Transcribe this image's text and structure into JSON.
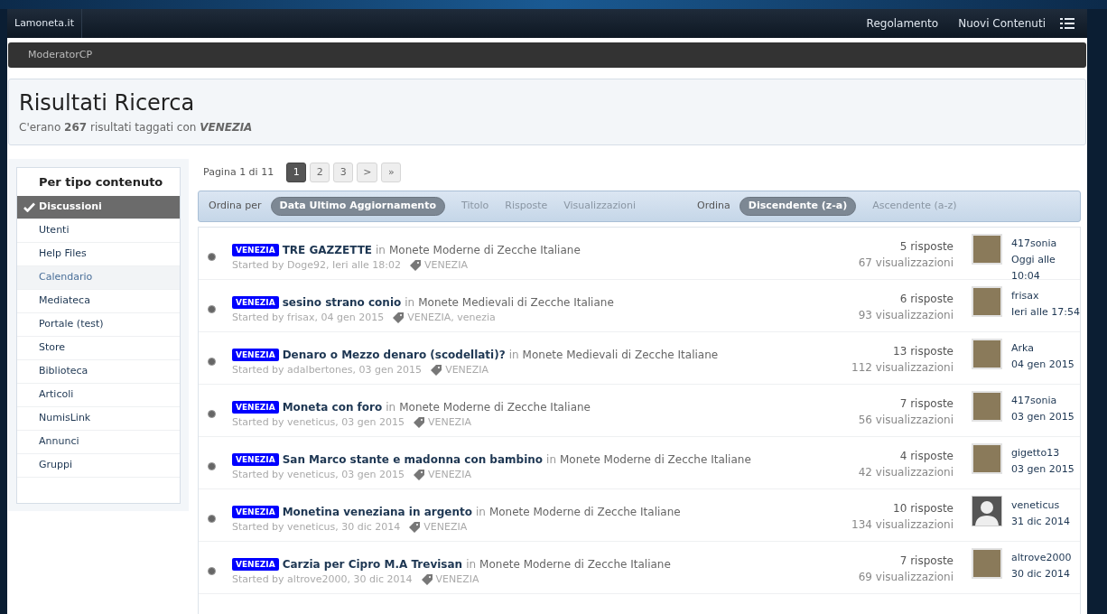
{
  "header": {
    "site": "Lamoneta.it",
    "links": [
      "Regolamento",
      "Nuovi Contenuti"
    ]
  },
  "subnav": {
    "label": "ModeratorCP"
  },
  "page": {
    "title": "Risultati Ricerca",
    "subtitle": "C'erano **267** risultati taggati con *VENEZIA*"
  },
  "sidebar": {
    "title": "Per tipo contenuto",
    "items": [
      {
        "label": "Discussioni",
        "selected": true,
        "hovered": false
      },
      {
        "label": "Utenti",
        "selected": false,
        "hovered": false
      },
      {
        "label": "Help Files",
        "selected": false,
        "hovered": false
      },
      {
        "label": "Calendario",
        "selected": false,
        "hovered": true
      },
      {
        "label": "Mediateca",
        "selected": false,
        "hovered": false
      },
      {
        "label": "Portale (test)",
        "selected": false,
        "hovered": false
      },
      {
        "label": "Store",
        "selected": false,
        "hovered": false
      },
      {
        "label": "Biblioteca",
        "selected": false,
        "hovered": false
      },
      {
        "label": "Articoli",
        "selected": false,
        "hovered": false
      },
      {
        "label": "NumisLink",
        "selected": false,
        "hovered": false
      },
      {
        "label": "Annunci",
        "selected": false,
        "hovered": false
      },
      {
        "label": "Gruppi",
        "selected": false,
        "hovered": false
      }
    ]
  },
  "pagination": {
    "label": "Pagina 1 di 11",
    "pages": [
      {
        "label": "1",
        "selected": true
      },
      {
        "label": "2",
        "selected": false
      },
      {
        "label": "3",
        "selected": false
      },
      {
        "label": ">",
        "selected": false
      },
      {
        "label": "»",
        "selected": false
      }
    ]
  },
  "sort_bar": {
    "sort_label": "Ordina per",
    "sort_options": [
      {
        "label": "Data Ultimo Aggiornamento",
        "selected": true
      },
      {
        "label": "Titolo",
        "selected": false
      },
      {
        "label": "Risposte",
        "selected": false
      },
      {
        "label": "Visualizzazioni",
        "selected": false
      }
    ],
    "order_label": "Ordina",
    "order_options": [
      {
        "label": "Discendente (z-a)",
        "selected": true
      },
      {
        "label": "Ascendente (a-z)",
        "selected": false
      }
    ]
  },
  "results": [
    {
      "prefix": "VENEZIA",
      "title": "TRE GAZZETTE",
      "in": "in",
      "forum": "Monete Moderne di Zecche Italiane",
      "started": "Started by Doge92, Ieri alle 18:02",
      "tags": "VENEZIA",
      "replies": "5 risposte",
      "views": "67 visualizzazioni",
      "kind": "photo",
      "last_user": "417sonia",
      "last_date": "Oggi alle 10:04"
    },
    {
      "prefix": "VENEZIA",
      "title": "sesino strano conio",
      "in": "in",
      "forum": "Monete Medievali di Zecche Italiane",
      "started": "Started by frisax, 04 gen 2015",
      "tags": "VENEZIA, venezia",
      "replies": "6 risposte",
      "views": "93 visualizzazioni",
      "kind": "photo",
      "last_user": "frisax",
      "last_date": "Ieri alle 17:54"
    },
    {
      "prefix": "VENEZIA",
      "title": "Denaro o Mezzo denaro (scodellati)?",
      "in": "in",
      "forum": "Monete Medievali di Zecche Italiane",
      "started": "Started by adalbertones, 03 gen 2015",
      "tags": "VENEZIA",
      "replies": "13 risposte",
      "views": "112 visualizzazioni",
      "kind": "photo",
      "last_user": "Arka",
      "last_date": "04 gen 2015"
    },
    {
      "prefix": "VENEZIA",
      "title": "Moneta con foro",
      "in": "in",
      "forum": "Monete Moderne di Zecche Italiane",
      "started": "Started by veneticus, 03 gen 2015",
      "tags": "VENEZIA",
      "replies": "7 risposte",
      "views": "56 visualizzazioni",
      "kind": "photo",
      "last_user": "417sonia",
      "last_date": "03 gen 2015"
    },
    {
      "prefix": "VENEZIA",
      "title": "San Marco stante e madonna con bambino",
      "in": "in",
      "forum": "Monete Moderne di Zecche Italiane",
      "started": "Started by veneticus, 03 gen 2015",
      "tags": "VENEZIA",
      "replies": "4 risposte",
      "views": "42 visualizzazioni",
      "kind": "photo",
      "last_user": "gigetto13",
      "last_date": "03 gen 2015"
    },
    {
      "prefix": "VENEZIA",
      "title": "Monetina veneziana in argento",
      "in": "in",
      "forum": "Monete Moderne di Zecche Italiane",
      "started": "Started by veneticus, 30 dic 2014",
      "tags": "VENEZIA",
      "replies": "10 risposte",
      "views": "134 visualizzazioni",
      "kind": "silhouette",
      "last_user": "veneticus",
      "last_date": "31 dic 2014"
    },
    {
      "prefix": "VENEZIA",
      "title": "Carzia per Cipro M.A Trevisan",
      "in": "in",
      "forum": "Monete Moderne di Zecche Italiane",
      "started": "Started by altrove2000, 30 dic 2014",
      "tags": "VENEZIA",
      "replies": "7 risposte",
      "views": "69 visualizzazioni",
      "kind": "photo",
      "last_user": "altrove2000",
      "last_date": "30 dic 2014"
    }
  ]
}
